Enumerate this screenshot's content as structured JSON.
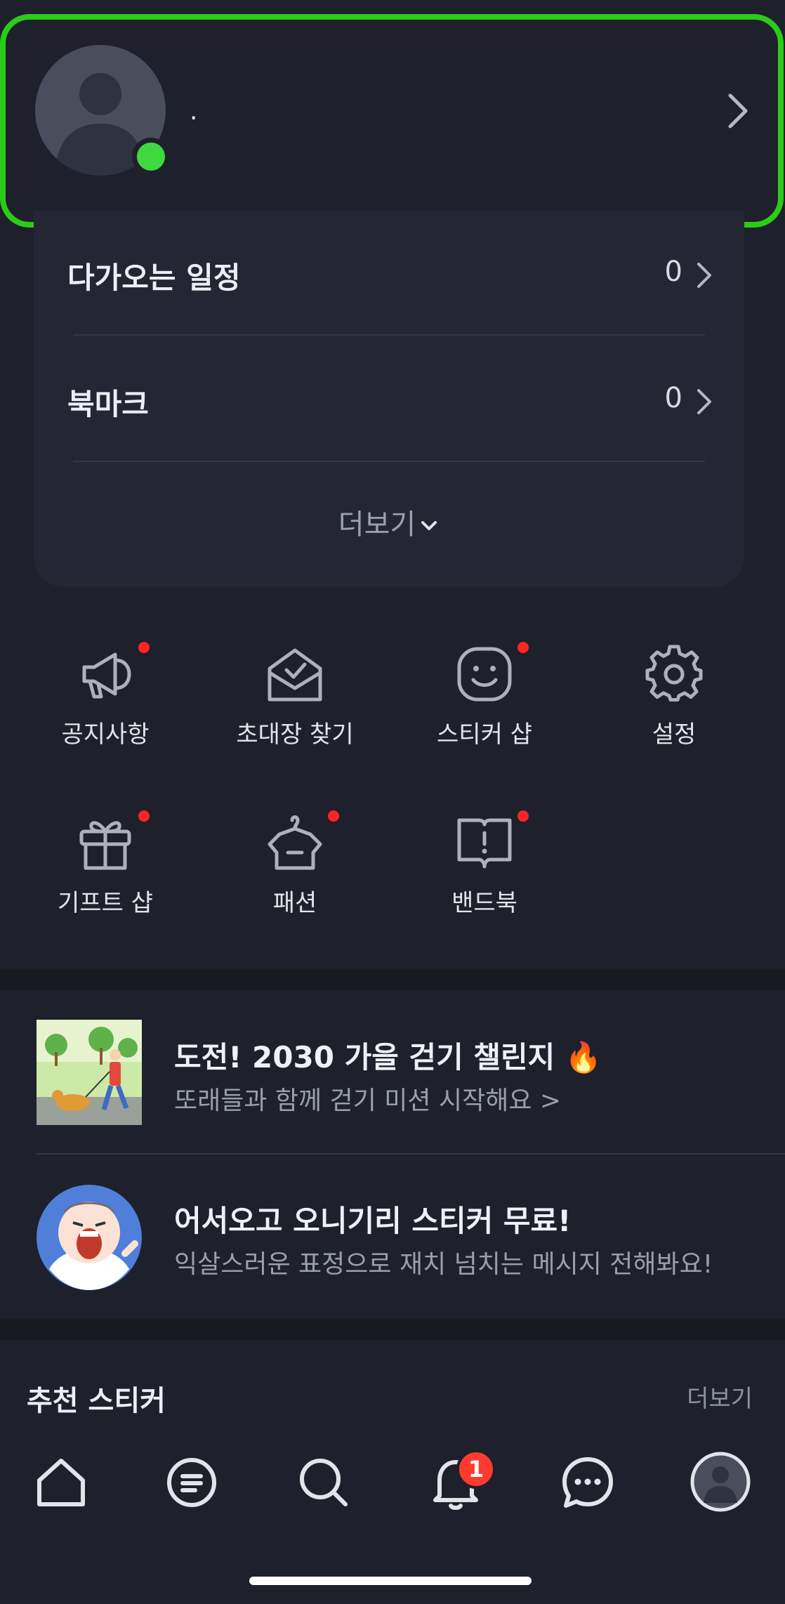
{
  "profile": {
    "name": "."
  },
  "summary": {
    "rows": [
      {
        "label": "다가오는 일정",
        "count": "0"
      },
      {
        "label": "북마크",
        "count": "0"
      }
    ],
    "more_label": "더보기"
  },
  "menu": {
    "items": [
      {
        "label": "공지사항",
        "icon": "megaphone-icon",
        "has_new": true
      },
      {
        "label": "초대장 찾기",
        "icon": "envelope-check-icon",
        "has_new": false
      },
      {
        "label": "스티커 샵",
        "icon": "smiley-icon",
        "has_new": true
      },
      {
        "label": "설정",
        "icon": "gear-icon",
        "has_new": false
      },
      {
        "label": "기프트 샵",
        "icon": "gift-icon",
        "has_new": true
      },
      {
        "label": "패션",
        "icon": "hanger-shirt-icon",
        "has_new": true
      },
      {
        "label": "밴드북",
        "icon": "book-icon",
        "has_new": true
      }
    ]
  },
  "promos": [
    {
      "title": "도전! 2030 가을 걷기 챌린지 🔥",
      "subtitle": "또래들과 함께 걷기 미션 시작해요 >"
    },
    {
      "title": "어서오고 오니기리 스티커 무료!",
      "subtitle": "익살스러운 표정으로 재치 넘치는 메시지 전해봐요!"
    }
  ],
  "recommended": {
    "title": "추천 스티커",
    "more_label": "더보기"
  },
  "bottom_nav": {
    "tabs": [
      "home-icon",
      "feed-icon",
      "search-icon",
      "notification-bell-icon",
      "chat-bubble-icon",
      "profile-avatar-icon"
    ],
    "notification_badge": "1"
  },
  "colors": {
    "background": "#1e202b",
    "card": "#242634",
    "highlight_border": "#2bcc18",
    "online": "#3fd83f",
    "new_dot": "#ff2424",
    "badge": "#ff3b30"
  }
}
